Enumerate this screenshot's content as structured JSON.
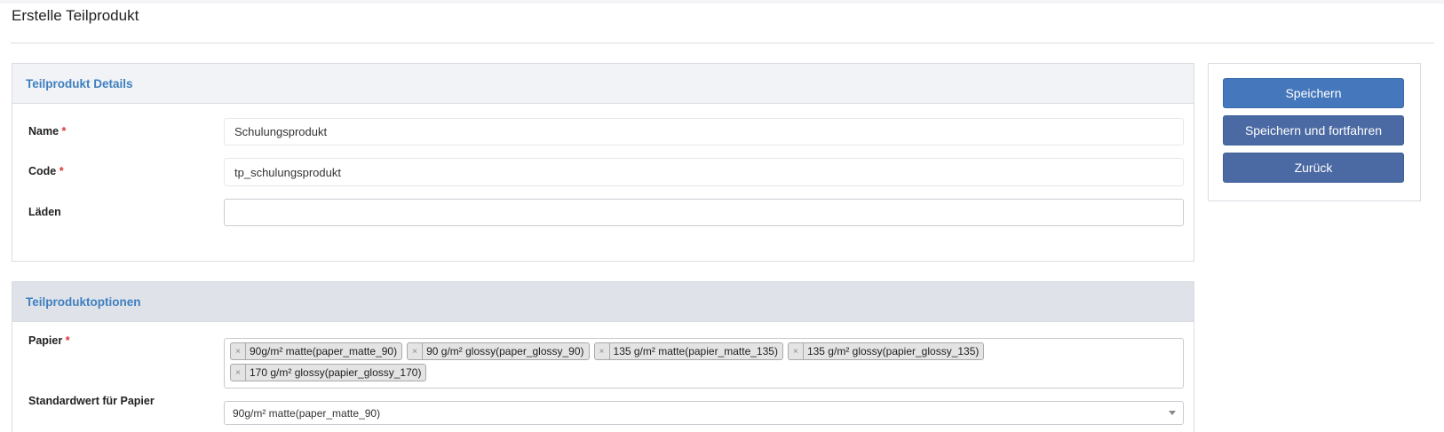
{
  "page": {
    "title": "Erstelle Teilprodukt"
  },
  "details": {
    "header": "Teilprodukt Details",
    "name": {
      "label": "Name",
      "required_mark": "*",
      "value": "Schulungsprodukt"
    },
    "code": {
      "label": "Code",
      "required_mark": "*",
      "value": "tp_schulungsprodukt"
    },
    "stores": {
      "label": "Läden",
      "value": ""
    }
  },
  "options": {
    "header": "Teilproduktoptionen",
    "paper": {
      "label": "Papier",
      "required_mark": "*",
      "remove_symbol": "×",
      "tags": [
        "90g/m² matte(paper_matte_90)",
        "90 g/m² glossy(paper_glossy_90)",
        "135 g/m² matte(papier_matte_135)",
        "135 g/m² glossy(papier_glossy_135)",
        "170 g/m² glossy(papier_glossy_170)"
      ]
    },
    "default_paper": {
      "label": "Standardwert für Papier",
      "value": "90g/m² matte(paper_matte_90)"
    }
  },
  "actions": {
    "save": "Speichern",
    "save_continue": "Speichern und fortfahren",
    "back": "Zurück"
  },
  "colors": {
    "primary": "#4477bb",
    "secondary": "#4b6aa3",
    "panel_header_text": "#3f7fbf",
    "required": "#dd3333"
  }
}
